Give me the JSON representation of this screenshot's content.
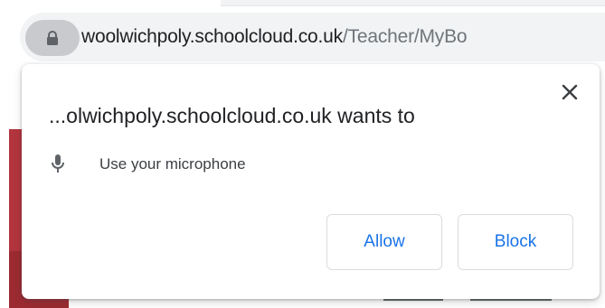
{
  "omnibox": {
    "host": "woolwichpoly.schoolcloud.co.uk",
    "path": "/Teacher/MyBo",
    "lock_icon": "lock-icon"
  },
  "popup": {
    "title": "...olwichpoly.schoolcloud.co.uk wants to",
    "permission_label": "Use your microphone",
    "permission_icon": "microphone-icon",
    "allow_label": "Allow",
    "block_label": "Block",
    "close_icon": "close-icon"
  },
  "colors": {
    "accent": "#1a73e8",
    "page_red": "#b3343d"
  }
}
